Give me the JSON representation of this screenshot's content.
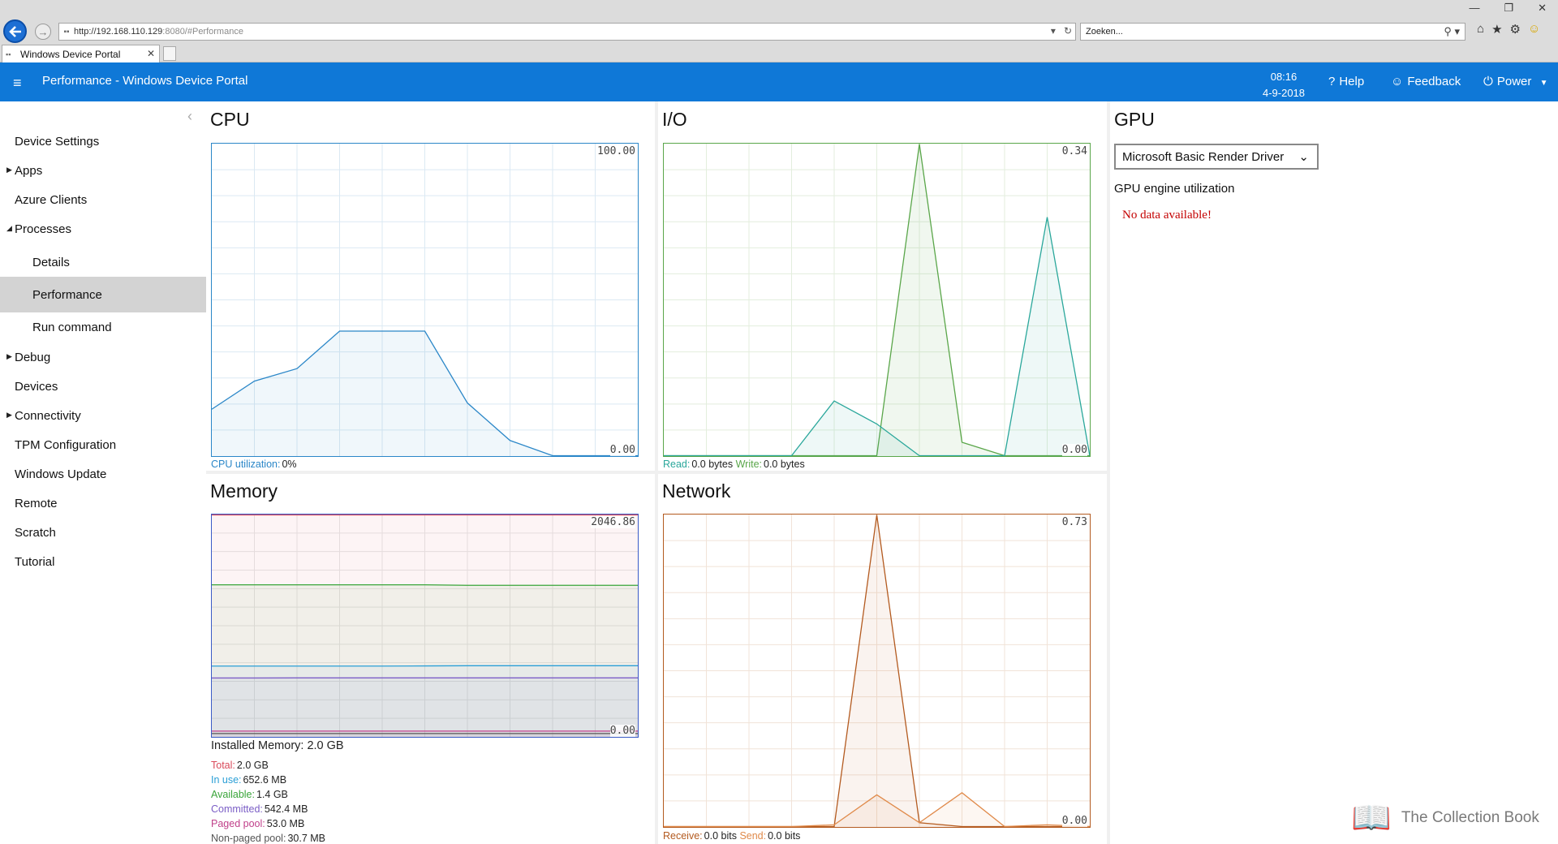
{
  "browser": {
    "url_host": "http://192.168.110.129",
    "url_rest": ":8080/#Performance",
    "search_placeholder": "Zoeken...",
    "tab_title": "Windows Device Portal"
  },
  "header": {
    "title": "Performance - Windows Device Portal",
    "time": "08:16",
    "date": "4-9-2018",
    "help": "Help",
    "feedback": "Feedback",
    "power": "Power"
  },
  "sidebar": {
    "items": [
      {
        "label": "Device Settings",
        "level": 0,
        "caret": ""
      },
      {
        "label": "Apps",
        "level": 0,
        "caret": "right"
      },
      {
        "label": "Azure Clients",
        "level": 0,
        "caret": ""
      },
      {
        "label": "Processes",
        "level": 0,
        "caret": "down"
      },
      {
        "label": "Details",
        "level": 1,
        "caret": ""
      },
      {
        "label": "Performance",
        "level": 1,
        "caret": "",
        "active": true
      },
      {
        "label": "Run command",
        "level": 1,
        "caret": ""
      },
      {
        "label": "Debug",
        "level": 0,
        "caret": "right"
      },
      {
        "label": "Devices",
        "level": 0,
        "caret": ""
      },
      {
        "label": "Connectivity",
        "level": 0,
        "caret": "right"
      },
      {
        "label": "TPM Configuration",
        "level": 0,
        "caret": ""
      },
      {
        "label": "Windows Update",
        "level": 0,
        "caret": ""
      },
      {
        "label": "Remote",
        "level": 0,
        "caret": ""
      },
      {
        "label": "Scratch",
        "level": 0,
        "caret": ""
      },
      {
        "label": "Tutorial",
        "level": 0,
        "caret": ""
      }
    ]
  },
  "cpu": {
    "title": "CPU",
    "ymax": "100.00",
    "ymin": "0.00",
    "util_label": "CPU utilization:",
    "util_value": "0%",
    "color": "#2b87c8"
  },
  "io": {
    "title": "I/O",
    "ymax": "0.34",
    "ymin": "0.00",
    "read_label": "Read:",
    "read_value": "0.0 bytes",
    "write_label": "Write:",
    "write_value": "0.0 bytes",
    "read_color": "#2aa79b",
    "write_color": "#5aa64a"
  },
  "memory": {
    "title": "Memory",
    "ymax": "2046.86",
    "ymin": "0.00",
    "installed": "Installed Memory: 2.0 GB",
    "stats": [
      {
        "label": "Total:",
        "value": "2.0 GB",
        "color": "#d94a5a"
      },
      {
        "label": "In use:",
        "value": "652.6 MB",
        "color": "#2a9fd6"
      },
      {
        "label": "Available:",
        "value": "1.4 GB",
        "color": "#3aa53a"
      },
      {
        "label": "Committed:",
        "value": "542.4 MB",
        "color": "#7b5ec6"
      },
      {
        "label": "Paged pool:",
        "value": "53.0 MB",
        "color": "#c0408a"
      },
      {
        "label": "Non-paged pool:",
        "value": "30.7 MB",
        "color": "#555555"
      }
    ]
  },
  "network": {
    "title": "Network",
    "ymax": "0.73",
    "ymin": "0.00",
    "receive_label": "Receive:",
    "receive_value": "0.0 bits",
    "send_label": "Send:",
    "send_value": "0.0 bits",
    "receive_color": "#b35a1f",
    "send_color": "#e08a4a"
  },
  "gpu": {
    "title": "GPU",
    "selected_adapter": "Microsoft Basic Render Driver",
    "engine_label": "GPU engine utilization",
    "no_data": "No data available!"
  },
  "watermark": "The Collection Book",
  "chart_data": [
    {
      "type": "area",
      "title": "CPU",
      "ylim": [
        0,
        100
      ],
      "grid": true,
      "series": [
        {
          "values": [
            15,
            24,
            28,
            40,
            40,
            40,
            17,
            5,
            0,
            0,
            0
          ]
        }
      ]
    },
    {
      "type": "area",
      "title": "I/O",
      "ylim": [
        0,
        0.34
      ],
      "grid": true,
      "series": [
        {
          "values": [
            0,
            0,
            0,
            0,
            0,
            0,
            0.34,
            0.015,
            0,
            0,
            0
          ]
        },
        {
          "values": [
            0,
            0,
            0,
            0,
            0.06,
            0.035,
            0,
            0,
            0,
            0.26,
            0
          ]
        }
      ]
    },
    {
      "type": "area",
      "title": "Memory",
      "ylim": [
        0,
        2046.86
      ],
      "grid": true,
      "series": [
        {
          "values": [
            2046.86,
            2046.86,
            2046.86,
            2046.86,
            2046.86,
            2046.86,
            2046.86,
            2046.86,
            2046.86,
            2046.86,
            2046.86
          ]
        },
        {
          "values": [
            1400,
            1400,
            1400,
            1400,
            1400,
            1400,
            1395,
            1395,
            1395,
            1395,
            1395
          ]
        },
        {
          "values": [
            652,
            652,
            652,
            652,
            652,
            653,
            655,
            655,
            655,
            655,
            655
          ]
        },
        {
          "values": [
            542,
            542,
            543,
            543,
            543,
            543,
            543,
            543,
            543,
            543,
            543
          ]
        },
        {
          "values": [
            53,
            53,
            53,
            53,
            53,
            53,
            53,
            53,
            53,
            53,
            53
          ]
        },
        {
          "values": [
            31,
            31,
            31,
            31,
            31,
            31,
            31,
            31,
            31,
            31,
            31
          ]
        }
      ]
    },
    {
      "type": "area",
      "title": "Network",
      "ylim": [
        0,
        0.73
      ],
      "grid": true,
      "series": [
        {
          "values": [
            0,
            0,
            0,
            0,
            0,
            0.73,
            0.01,
            0,
            0,
            0,
            0
          ]
        },
        {
          "values": [
            0,
            0,
            0,
            0,
            0.005,
            0.075,
            0.01,
            0.08,
            0,
            0.005,
            0
          ]
        }
      ]
    }
  ]
}
